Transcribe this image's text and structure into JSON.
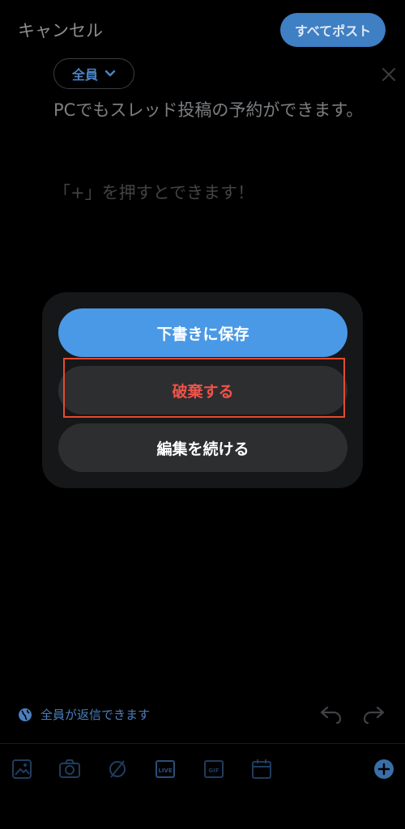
{
  "header": {
    "cancel_label": "キャンセル",
    "post_all_label": "すべてポスト"
  },
  "composer": {
    "audience_label": "全員",
    "text": "PCでもスレッド投稿の予約ができます。",
    "placeholder": "「+」を押すとできます！"
  },
  "dialog": {
    "save_draft_label": "下書きに保存",
    "discard_label": "破棄する",
    "continue_label": "編集を続ける"
  },
  "footer": {
    "reply_setting_label": "全員が返信できます"
  },
  "toolbar": {
    "items": [
      "image-icon",
      "camera-icon",
      "no-image-icon",
      "live-icon",
      "gif-icon",
      "calendar-icon",
      "add-icon"
    ],
    "live_label": "LIVE",
    "gif_label": "GIF"
  },
  "colors": {
    "accent": "#4a99e6",
    "danger": "#f0524a",
    "highlight": "#e44b2f"
  }
}
